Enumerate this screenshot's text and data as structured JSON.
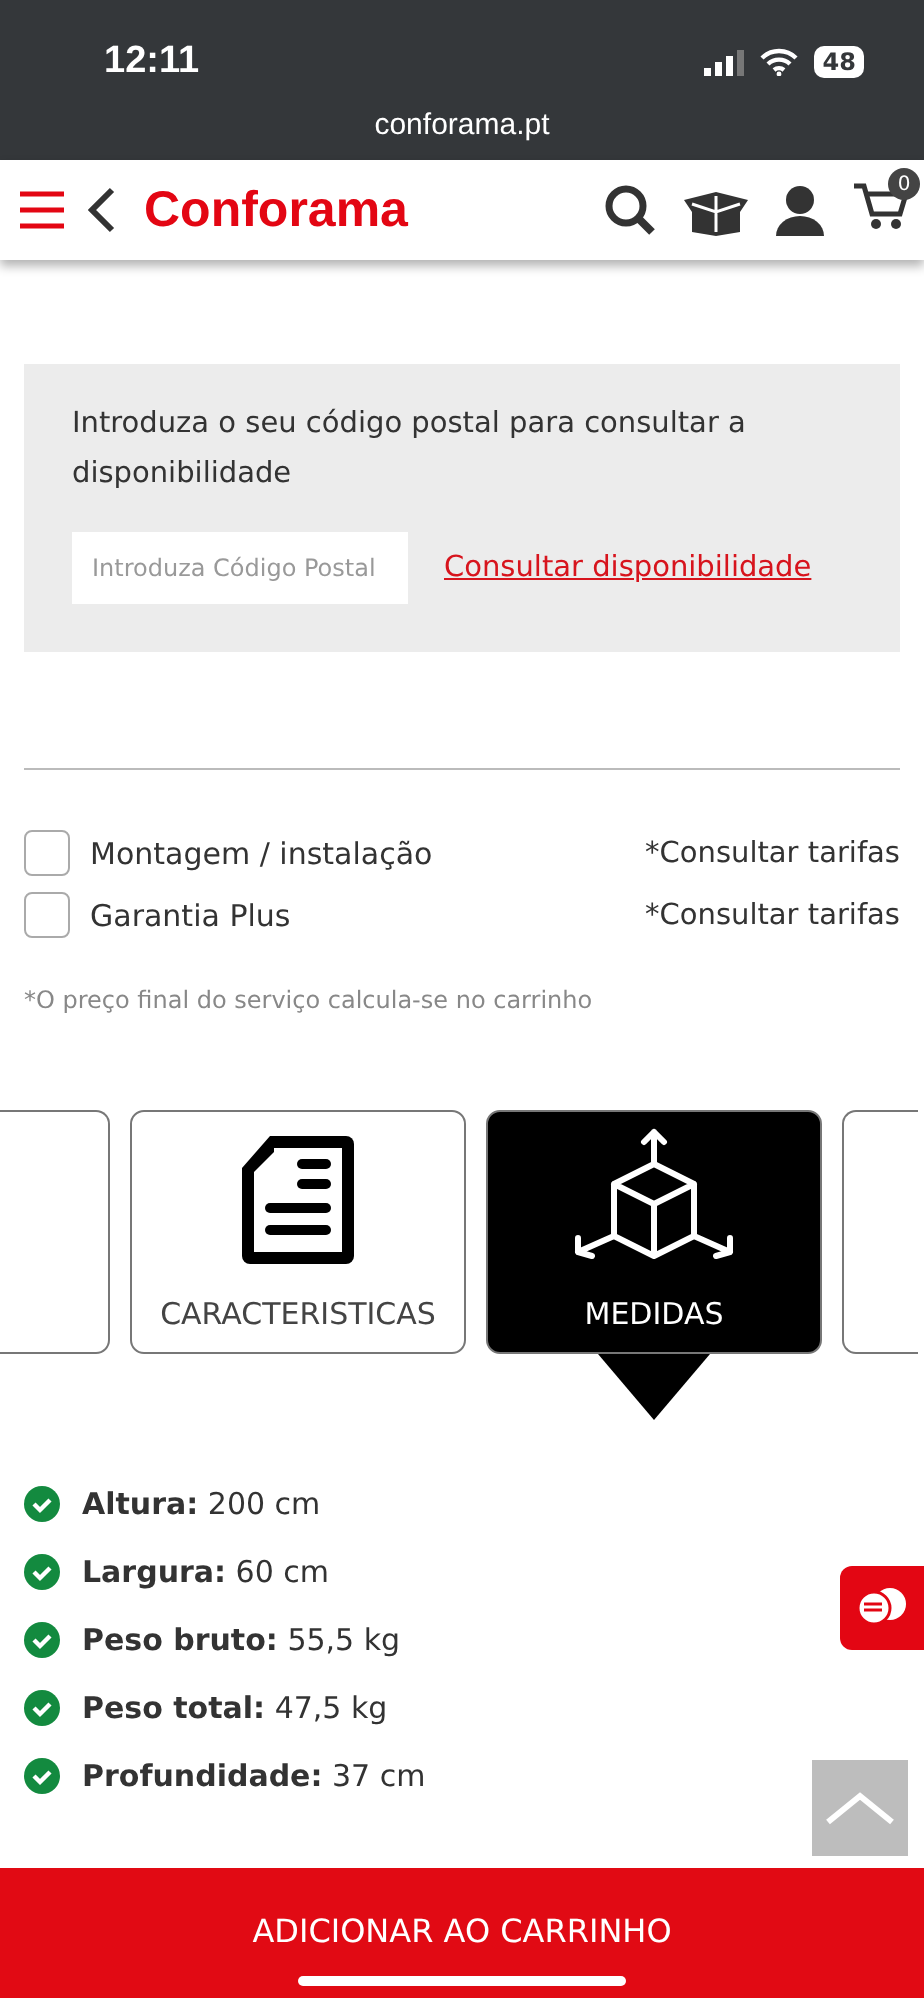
{
  "status_bar": {
    "time": "12:11",
    "battery": "48"
  },
  "address_bar": {
    "url": "conforama.pt"
  },
  "header": {
    "logo": "Conforama",
    "cart_count": "0"
  },
  "availability": {
    "text": "Introduza o seu código postal para consultar a disponibilidade",
    "placeholder": "Introduza Código Postal",
    "link": "Consultar disponibilidade"
  },
  "services": [
    {
      "label": "Montagem / instalação",
      "note": "*Consultar tarifas",
      "checked": false
    },
    {
      "label": "Garantia Plus",
      "note": "*Consultar tarifas",
      "checked": false
    }
  ],
  "services_note": "*O preço final do serviço calcula-se no carrinho",
  "tabs": [
    {
      "kind": "partial",
      "selected": false
    },
    {
      "kind": "document",
      "label": "CARACTERISTICAS",
      "selected": false
    },
    {
      "kind": "cube",
      "label": "MEDIDAS",
      "selected": true
    },
    {
      "kind": "partial",
      "selected": false
    }
  ],
  "measures": [
    {
      "name": "Altura:",
      "value": "200 cm"
    },
    {
      "name": "Largura:",
      "value": "60 cm"
    },
    {
      "name": "Peso bruto:",
      "value": "55,5 kg"
    },
    {
      "name": "Peso total:",
      "value": "47,5 kg"
    },
    {
      "name": "Profundidade:",
      "value": "37 cm"
    }
  ],
  "add_to_cart": "ADICIONAR AO CARRINHO"
}
